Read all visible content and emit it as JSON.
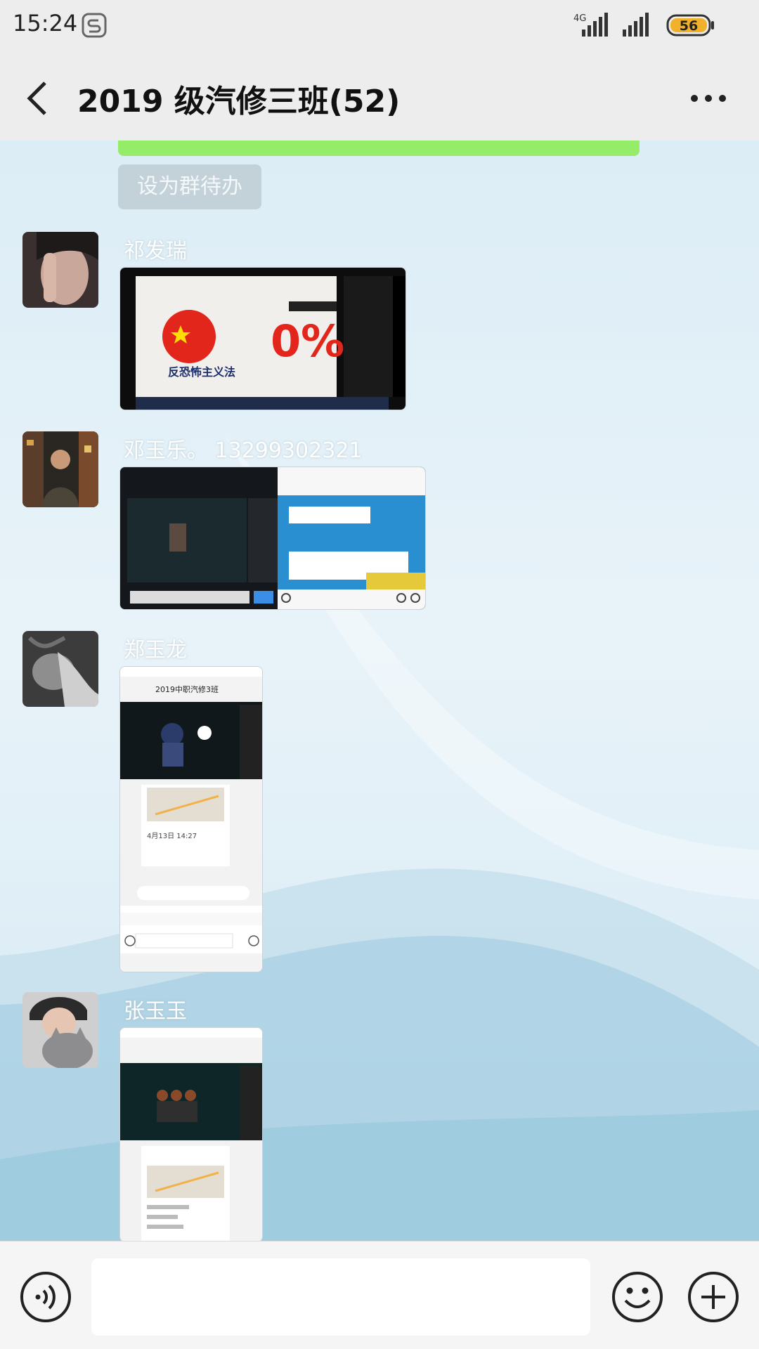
{
  "status_bar": {
    "time": "15:24",
    "network": "4G",
    "battery": "56"
  },
  "header": {
    "title": "2019 级汽修三班(52)"
  },
  "todo_button_label": "设为群待办",
  "messages": [
    {
      "sender": "祁发瑞",
      "image": {
        "overlay_text": "0%",
        "caption": "反恐怖主义法"
      }
    },
    {
      "sender": "邓玉乐。 13299302321"
    },
    {
      "sender": "郑玉龙",
      "image": {
        "top_bar_title": "2019中职汽修3班",
        "time_label": "4月13日 14:27"
      }
    },
    {
      "sender": "张玉玉"
    }
  ],
  "input": {
    "placeholder": ""
  },
  "icons": {
    "back": "chevron-left-icon",
    "more": "more-dots-icon",
    "voice": "voice-icon",
    "emoji": "emoji-icon",
    "plus": "plus-icon"
  },
  "colors": {
    "header_bg": "#ededed",
    "my_bubble": "#95ec69",
    "input_bar_bg": "#f5f5f5"
  }
}
